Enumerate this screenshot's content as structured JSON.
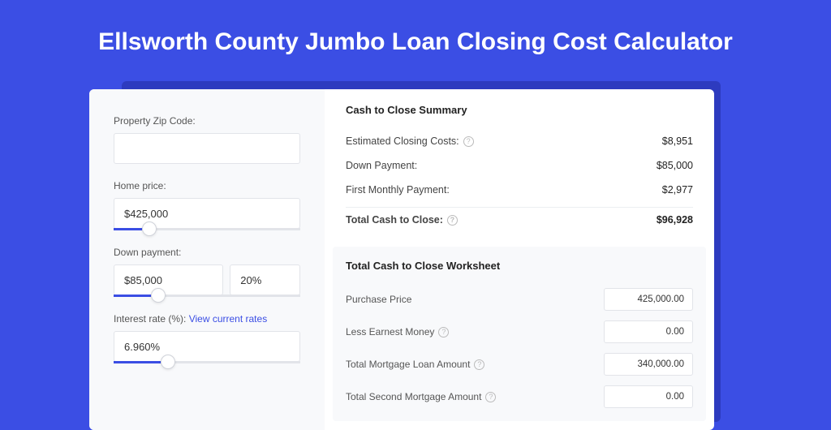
{
  "header": {
    "title": "Ellsworth County Jumbo Loan Closing Cost Calculator"
  },
  "form": {
    "zip": {
      "label": "Property Zip Code:",
      "value": ""
    },
    "home_price": {
      "label": "Home price:",
      "value": "$425,000",
      "slider_pct": 15
    },
    "down_payment": {
      "label": "Down payment:",
      "value": "$85,000",
      "pct": "20%",
      "slider_pct": 20
    },
    "interest_rate": {
      "label": "Interest rate (%): ",
      "link_text": "View current rates",
      "value": "6.960%",
      "slider_pct": 25
    }
  },
  "summary": {
    "title": "Cash to Close Summary",
    "rows": [
      {
        "label": "Estimated Closing Costs:",
        "value": "$8,951",
        "help": true
      },
      {
        "label": "Down Payment:",
        "value": "$85,000",
        "help": false
      },
      {
        "label": "First Monthly Payment:",
        "value": "$2,977",
        "help": false
      }
    ],
    "total": {
      "label": "Total Cash to Close:",
      "value": "$96,928",
      "help": true
    }
  },
  "worksheet": {
    "title": "Total Cash to Close Worksheet",
    "rows": [
      {
        "label": "Purchase Price",
        "value": "425,000.00",
        "help": false
      },
      {
        "label": "Less Earnest Money",
        "value": "0.00",
        "help": true
      },
      {
        "label": "Total Mortgage Loan Amount",
        "value": "340,000.00",
        "help": true
      },
      {
        "label": "Total Second Mortgage Amount",
        "value": "0.00",
        "help": true
      }
    ]
  }
}
